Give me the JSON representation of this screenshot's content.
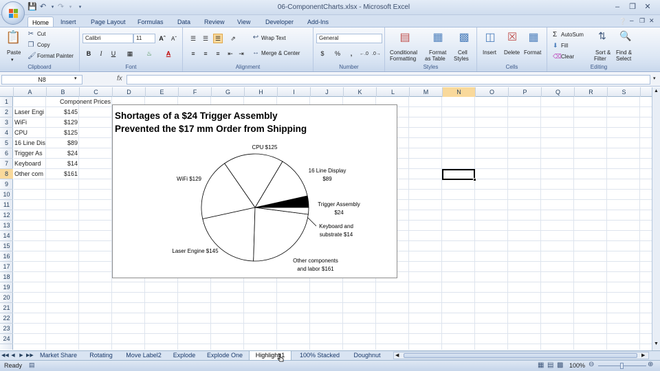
{
  "app": {
    "title": "06-ComponentCharts.xlsx - Microsoft Excel",
    "tabs": [
      "Home",
      "Insert",
      "Page Layout",
      "Formulas",
      "Data",
      "Review",
      "View",
      "Developer",
      "Add-Ins"
    ],
    "active_tab": "Home"
  },
  "ribbon": {
    "clipboard": {
      "paste": "Paste",
      "cut": "Cut",
      "copy": "Copy",
      "format_painter": "Format Painter",
      "label": "Clipboard"
    },
    "font": {
      "name": "Calibri",
      "size": "11",
      "bold": "B",
      "italic": "I",
      "underline": "U",
      "label": "Font"
    },
    "alignment": {
      "wrap_text": "Wrap Text",
      "merge_center": "Merge & Center",
      "label": "Alignment"
    },
    "number": {
      "format": "General",
      "currency": "$",
      "percent": "%",
      "comma": ",",
      "label": "Number"
    },
    "styles": {
      "conditional": "Conditional",
      "conditional2": "Formatting",
      "format_table": "Format",
      "format_table2": "as Table",
      "cell_styles": "Cell",
      "cell_styles2": "Styles",
      "label": "Styles"
    },
    "cells": {
      "insert": "Insert",
      "delete": "Delete",
      "format": "Format",
      "label": "Cells"
    },
    "editing": {
      "autosum": "AutoSum",
      "fill": "Fill",
      "clear": "Clear",
      "sort": "Sort &",
      "sort2": "Filter",
      "find": "Find &",
      "find2": "Select",
      "label": "Editing"
    }
  },
  "formula_bar": {
    "name_box": "N8",
    "fx": "fx",
    "value": ""
  },
  "columns": [
    "A",
    "B",
    "C",
    "D",
    "E",
    "F",
    "G",
    "H",
    "I",
    "J",
    "K",
    "L",
    "M",
    "N",
    "O",
    "P",
    "Q",
    "R",
    "S"
  ],
  "selected_column": "N",
  "rows": [
    "1",
    "2",
    "3",
    "4",
    "5",
    "6",
    "7",
    "8",
    "9",
    "10",
    "11",
    "12",
    "13",
    "14",
    "15",
    "16",
    "17",
    "18",
    "19",
    "20",
    "21",
    "22",
    "23",
    "24"
  ],
  "selected_row": "8",
  "cells": {
    "header": "Component Prices",
    "items": [
      {
        "name": "Laser Engi",
        "price": "$145"
      },
      {
        "name": "WiFi",
        "price": "$129"
      },
      {
        "name": "CPU",
        "price": "$125"
      },
      {
        "name": "16 Line Dis",
        "price": "$89"
      },
      {
        "name": "Trigger As",
        "price": "$24"
      },
      {
        "name": "Keyboard",
        "price": "$14"
      },
      {
        "name": "Other com",
        "price": "$161"
      }
    ]
  },
  "chart_data": {
    "type": "pie",
    "title": "Shortages of a $24 Trigger Assembly\nPrevented the $17 mm Order from Shipping",
    "slices": [
      {
        "name": "Trigger Assembly",
        "value": 24,
        "label": [
          "Trigger Assembly",
          "$24"
        ],
        "fill": "#000000"
      },
      {
        "name": "16 Line Display",
        "value": 89,
        "label": [
          "16 Line Display",
          "$89"
        ],
        "fill": "#ffffff"
      },
      {
        "name": "CPU",
        "value": 125,
        "label": [
          "CPU $125"
        ],
        "fill": "#ffffff"
      },
      {
        "name": "WiFi",
        "value": 129,
        "label": [
          "WiFi $129"
        ],
        "fill": "#ffffff"
      },
      {
        "name": "Laser Engine",
        "value": 145,
        "label": [
          "Laser Engine $145"
        ],
        "fill": "#ffffff"
      },
      {
        "name": "Other components and labor",
        "value": 161,
        "label": [
          "Other components",
          "and labor $161"
        ],
        "fill": "#ffffff"
      },
      {
        "name": "Keyboard and substrate",
        "value": 14,
        "label": [
          "Keyboard and",
          "substrate $14"
        ],
        "fill": "#ffffff"
      }
    ]
  },
  "sheet_tabs": [
    "Market Share",
    "Rotating",
    "Move Label2",
    "Explode",
    "Explode One",
    "Highlight 1",
    "100% Stacked",
    "Doughnut"
  ],
  "active_sheet": "Highlight 1",
  "status": {
    "ready": "Ready",
    "zoom": "100%"
  },
  "colors": {
    "ribbon": "#dbe6f4",
    "selected_header": "#f9d99b",
    "slice_highlight": "#000000"
  }
}
